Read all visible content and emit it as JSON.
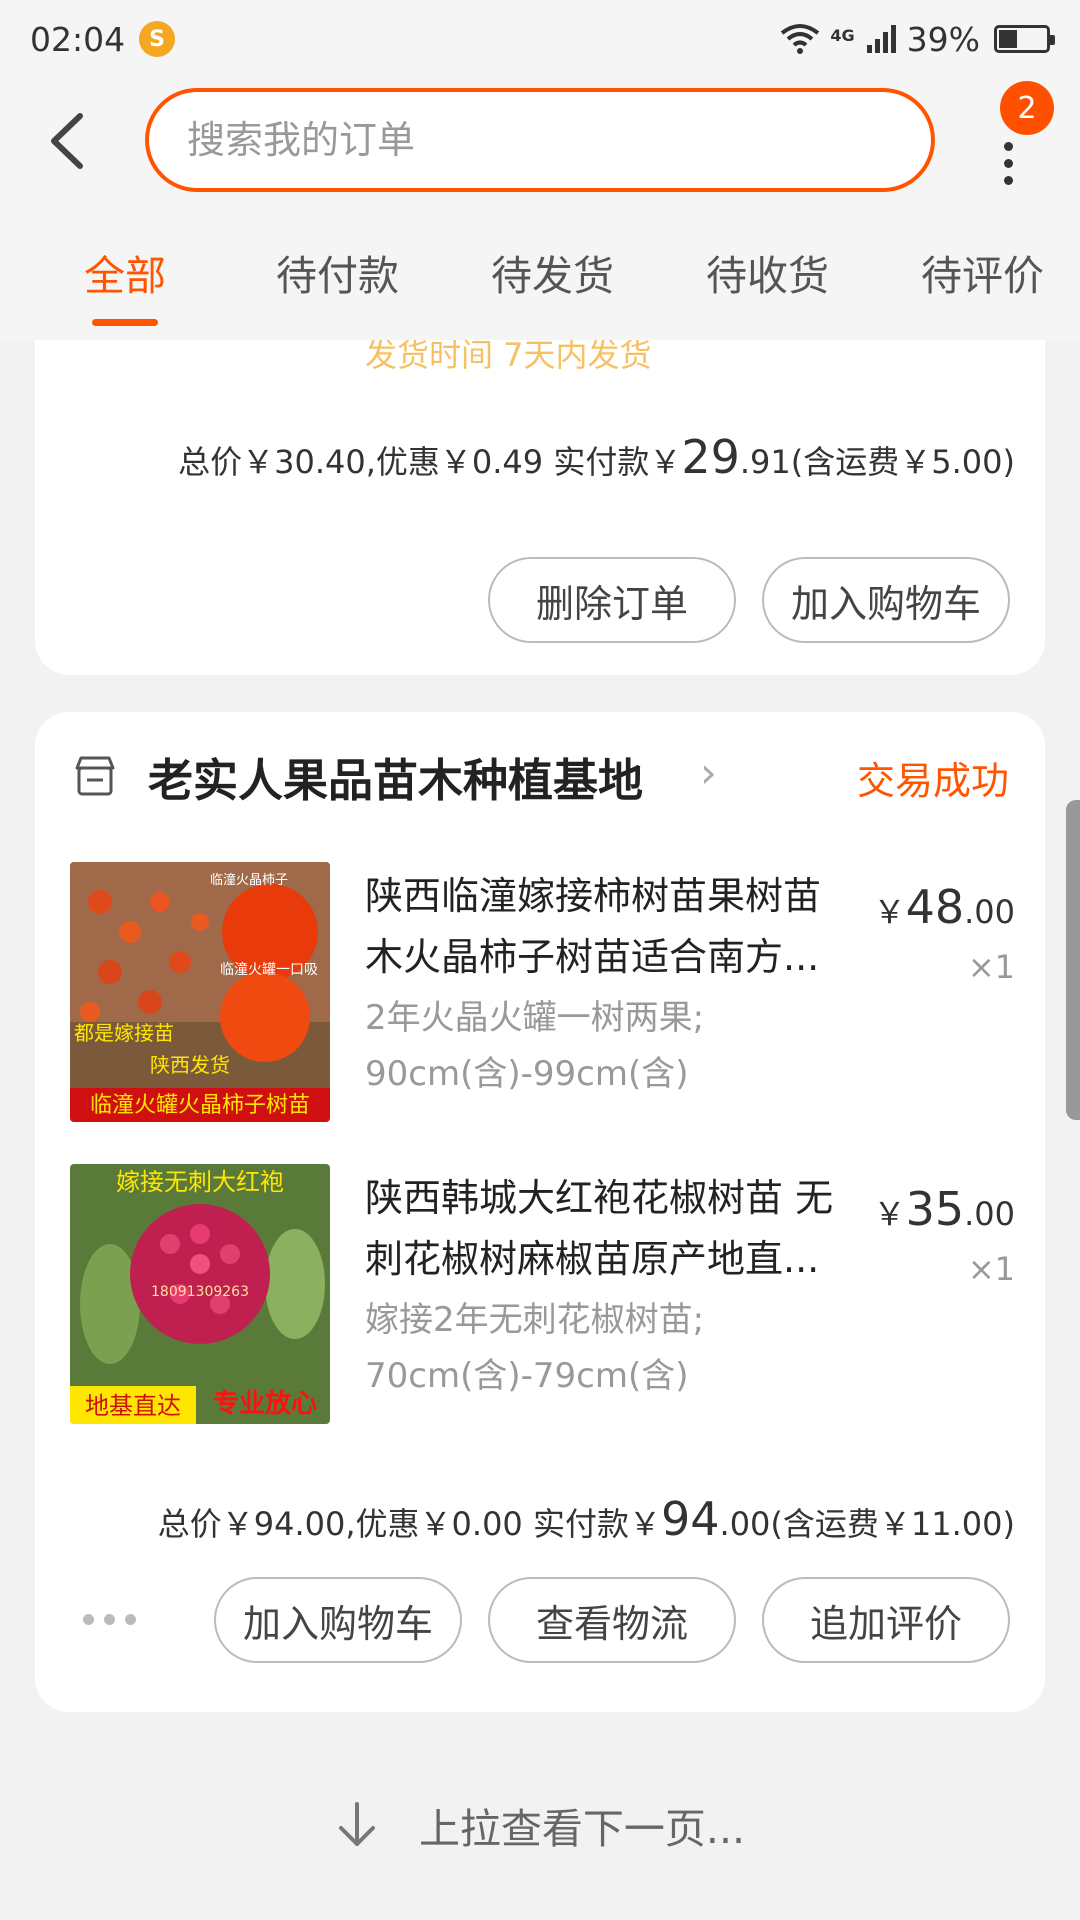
{
  "status_bar": {
    "time": "02:04",
    "network": "4G",
    "battery_percent_text": "39%",
    "battery_level": 0.39
  },
  "header": {
    "search_placeholder": "搜索我的订单",
    "notification_badge": "2"
  },
  "tabs": [
    {
      "label": "全部",
      "active": true
    },
    {
      "label": "待付款",
      "active": false
    },
    {
      "label": "待发货",
      "active": false
    },
    {
      "label": "待收货",
      "active": false
    },
    {
      "label": "待评价",
      "active": false
    }
  ],
  "order1": {
    "ship_note": "发货时间 7天内发货",
    "summary_prefix": "总价￥30.40,优惠￥0.49 实付款￥",
    "paid_int": "29",
    "paid_dec": ".91",
    "summary_suffix": "(含运费￥5.00)",
    "buttons": {
      "delete": "删除订单",
      "add_cart": "加入购物车"
    }
  },
  "order2": {
    "shop_name": "老实人果品苗木种植基地",
    "status": "交易成功",
    "items": [
      {
        "title": "陕西临潼嫁接柿树苗果树苗木火晶柿子树苗适合南方...",
        "spec_line1": "2年火晶火罐一树两果;",
        "spec_line2": "90cm(含)-99cm(含)",
        "price_symbol": "￥",
        "price_int": "48",
        "price_dec": ".00",
        "qty": "×1",
        "image_text_top": "临潼火晶柿子",
        "image_text_mid1": "都是嫁接苗",
        "image_text_mid2": "陕西发货",
        "image_text_bottom": "临潼火罐火晶柿子树苗",
        "image_text_side": "临潼火罐一口吸"
      },
      {
        "title": "陕西韩城大红袍花椒树苗 无刺花椒树麻椒苗原产地直...",
        "spec_line1": "嫁接2年无刺花椒树苗;",
        "spec_line2": "70cm(含)-79cm(含)",
        "price_symbol": "￥",
        "price_int": "35",
        "price_dec": ".00",
        "qty": "×1",
        "image_text_top": "嫁接无刺大红袍",
        "image_text_phone": "18091309263",
        "image_text_bottom_left": "地基直达",
        "image_text_bottom_right": "专业放心"
      }
    ],
    "summary_prefix": "总价￥94.00,优惠￥0.00 实付款￥",
    "paid_int": "94",
    "paid_dec": ".00",
    "summary_suffix": "(含运费￥11.00)",
    "buttons": {
      "add_cart": "加入购物车",
      "logistics": "查看物流",
      "review": "追加评价"
    }
  },
  "footer": {
    "load_more": "上拉查看下一页..."
  },
  "colors": {
    "accent": "#ff5500",
    "badge": "#ff5000",
    "ship_note": "#f5a623"
  }
}
